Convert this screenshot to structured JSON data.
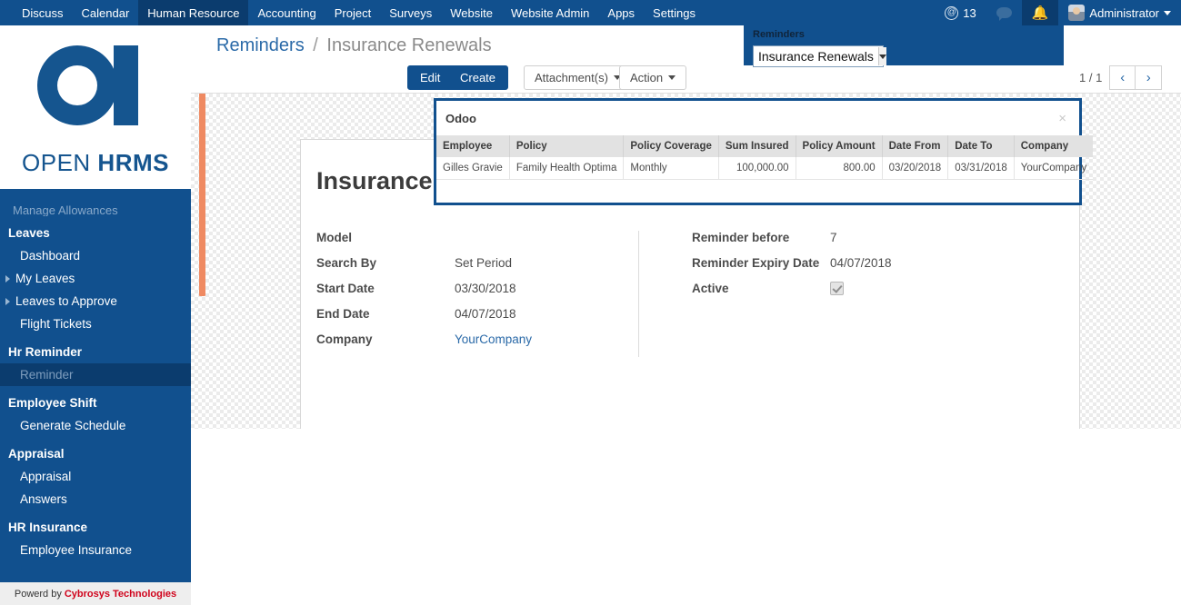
{
  "topnav": {
    "items": [
      {
        "label": "Discuss",
        "active": false
      },
      {
        "label": "Calendar",
        "active": false
      },
      {
        "label": "Human Resource",
        "active": true
      },
      {
        "label": "Accounting",
        "active": false
      },
      {
        "label": "Project",
        "active": false
      },
      {
        "label": "Surveys",
        "active": false
      },
      {
        "label": "Website",
        "active": false
      },
      {
        "label": "Website Admin",
        "active": false
      },
      {
        "label": "Apps",
        "active": false
      },
      {
        "label": "Settings",
        "active": false
      }
    ],
    "mention_count": "13",
    "user_name": "Administrator"
  },
  "sidebar": {
    "logo": {
      "open": "OPEN ",
      "hrms": "HRMS"
    },
    "clipped_item": "Manage Allowances",
    "sections": [
      {
        "title": "Leaves",
        "items": [
          {
            "label": "Dashboard",
            "arrow": false,
            "active": false
          },
          {
            "label": "My Leaves",
            "arrow": true,
            "active": false
          },
          {
            "label": "Leaves to Approve",
            "arrow": true,
            "active": false
          },
          {
            "label": "Flight Tickets",
            "arrow": false,
            "active": false
          }
        ]
      },
      {
        "title": "Hr Reminder",
        "items": [
          {
            "label": "Reminder",
            "arrow": false,
            "active": true
          }
        ]
      },
      {
        "title": "Employee Shift",
        "items": [
          {
            "label": "Generate Schedule",
            "arrow": false,
            "active": false
          }
        ]
      },
      {
        "title": "Appraisal",
        "items": [
          {
            "label": "Appraisal",
            "arrow": false,
            "active": false
          },
          {
            "label": "Answers",
            "arrow": false,
            "active": false
          }
        ]
      },
      {
        "title": "HR Insurance",
        "items": [
          {
            "label": "Employee Insurance",
            "arrow": false,
            "active": false
          }
        ]
      }
    ],
    "footer_prefix": "Powerd by",
    "footer_brand": "Cybrosys Technologies"
  },
  "control_panel": {
    "breadcrumb_root": "Reminders",
    "breadcrumb_sep": "/",
    "breadcrumb_leaf": "Insurance Renewals",
    "edit_label": "Edit",
    "create_label": "Create",
    "attachments_label": "Attachment(s)",
    "action_label": "Action",
    "pager_count": "1 / 1",
    "pager_prev": "‹",
    "pager_next": "›"
  },
  "reminders_panel": {
    "label": "Reminders",
    "selected": "Insurance Renewals"
  },
  "form": {
    "title": "Insurance",
    "left": [
      {
        "label": "Model",
        "value": ""
      },
      {
        "label": "Search By",
        "value": "Set Period"
      },
      {
        "label": "Start Date",
        "value": "03/30/2018"
      },
      {
        "label": "End Date",
        "value": "04/07/2018"
      },
      {
        "label": "Company",
        "value": "YourCompany",
        "link": true
      }
    ],
    "right": [
      {
        "label": "Reminder before",
        "value": "7"
      },
      {
        "label": "Reminder Expiry Date",
        "value": "04/07/2018"
      },
      {
        "label": "Active",
        "value": "",
        "checkbox": true,
        "checked": true
      }
    ]
  },
  "dialog": {
    "title": "Odoo",
    "close": "×",
    "columns": [
      {
        "label": "Employee",
        "align": "left"
      },
      {
        "label": "Policy",
        "align": "left"
      },
      {
        "label": "Policy Coverage",
        "align": "left"
      },
      {
        "label": "Sum Insured",
        "align": "right"
      },
      {
        "label": "Policy Amount",
        "align": "right"
      },
      {
        "label": "Date From",
        "align": "left"
      },
      {
        "label": "Date To",
        "align": "left"
      },
      {
        "label": "Company",
        "align": "left"
      }
    ],
    "rows": [
      {
        "employee": "Gilles Gravie",
        "policy": "Family Health Optima",
        "coverage": "Monthly",
        "sum_insured": "100,000.00",
        "policy_amount": "800.00",
        "date_from": "03/20/2018",
        "date_to": "03/31/2018",
        "company": "YourCompany"
      }
    ]
  },
  "colors": {
    "brand_blue": "#11508e",
    "brand_dark": "#0b3c6e",
    "link": "#2b6aa8",
    "scroll_thumb": "#ef8a62",
    "footer_brand": "#d0021b"
  }
}
